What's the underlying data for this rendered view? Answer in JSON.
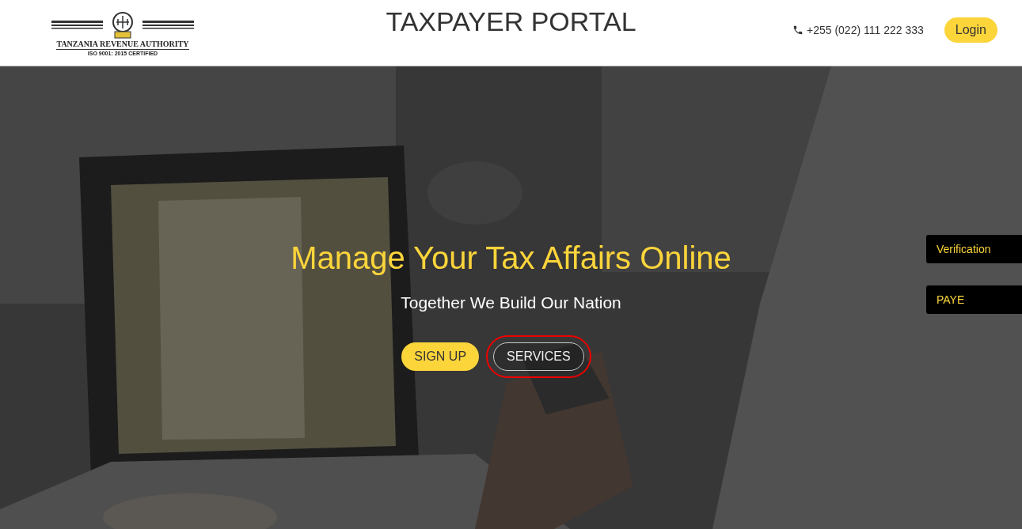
{
  "header": {
    "logo": {
      "name": "TANZANIA REVENUE AUTHORITY",
      "certification": "ISO 9001: 2015 CERTIFIED"
    },
    "title": "TAXPAYER PORTAL",
    "phone": "+255 (022) 111 222 333",
    "login_button": "Login"
  },
  "hero": {
    "headline": "Manage Your Tax Affairs Online",
    "tagline": "Together We Build Our Nation",
    "buttons": [
      {
        "label": "SIGN UP",
        "kind": "primary",
        "highlighted": false
      },
      {
        "label": "SERVICES",
        "kind": "outline",
        "highlighted": true
      }
    ]
  },
  "side_tabs": [
    {
      "label": "Verification"
    },
    {
      "label": "PAYE"
    }
  ]
}
